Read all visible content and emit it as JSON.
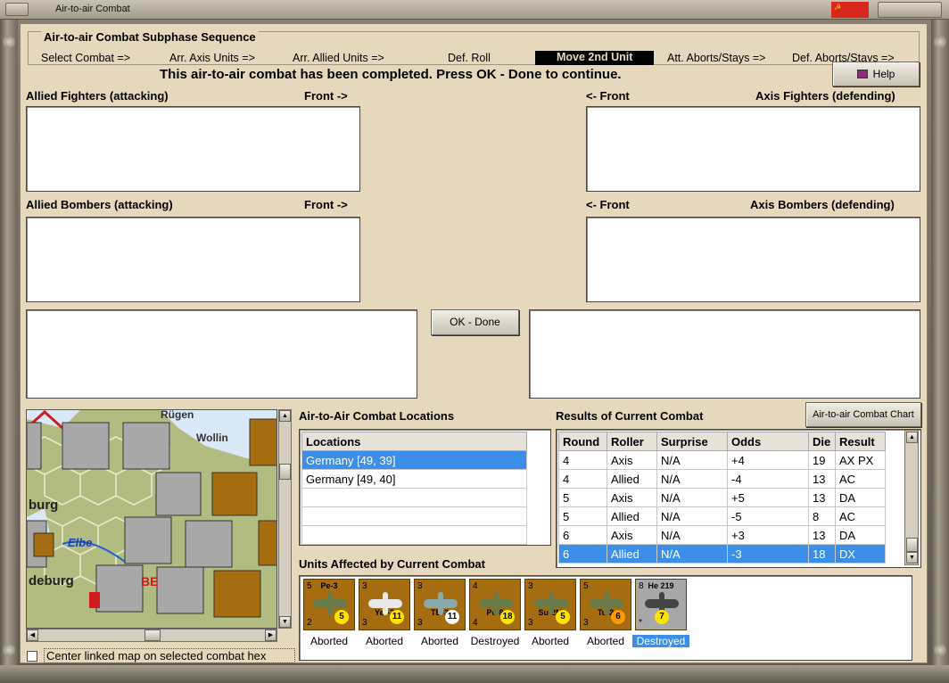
{
  "window": {
    "title": "Air-to-air Combat"
  },
  "sequence": {
    "title": "Air-to-air Combat Subphase Sequence",
    "steps": [
      "Select Combat =>",
      "Arr. Axis Units =>",
      "Arr. Allied Units =>",
      "Def. Roll",
      "Move 2nd Unit",
      "Att. Aborts/Stays =>",
      "Def. Aborts/Stays =>"
    ],
    "active_index": 4
  },
  "message": "This air-to-air combat has been completed.  Press OK - Done to continue.",
  "help_label": "Help",
  "labels": {
    "allied_fighters": "Allied Fighters (attacking)",
    "front_right": "Front ->",
    "front_left": "<- Front",
    "axis_fighters": "Axis Fighters (defending)",
    "allied_bombers": "Allied Bombers (attacking)",
    "axis_bombers": "Axis Bombers (defending)"
  },
  "ok_label": "OK - Done",
  "map": {
    "labels": [
      "Rügen",
      "Wollin",
      "burg",
      "Elbe",
      "deburg",
      "BE"
    ]
  },
  "locations": {
    "title": "Air-to-Air Combat Locations",
    "header": "Locations",
    "rows": [
      "Germany [49, 39]",
      "Germany [49, 40]"
    ],
    "selected": 0
  },
  "results": {
    "title": "Results of Current Combat",
    "chart_button": "Air-to-air Combat Chart",
    "headers": [
      "Round",
      "Roller",
      "Surprise",
      "Odds",
      "Die",
      "Result"
    ],
    "rows": [
      [
        "4",
        "Axis",
        "N/A",
        "+4",
        "19",
        "AX PX"
      ],
      [
        "4",
        "Allied",
        "N/A",
        "-4",
        "13",
        "AC"
      ],
      [
        "5",
        "Axis",
        "N/A",
        "+5",
        "13",
        "DA"
      ],
      [
        "5",
        "Allied",
        "N/A",
        "-5",
        "8",
        "AC"
      ],
      [
        "6",
        "Axis",
        "N/A",
        "+3",
        "13",
        "DA"
      ],
      [
        "6",
        "Allied",
        "N/A",
        "-3",
        "18",
        "DX"
      ]
    ],
    "selected": 5
  },
  "units": {
    "title": "Units Affected by Current Combat",
    "items": [
      {
        "name": "Pe-3",
        "status": "Aborted",
        "die": "5",
        "tl": "5",
        "bl": "2"
      },
      {
        "name": "Yer-2",
        "status": "Aborted",
        "die": "11",
        "tl": "3",
        "bl": "3"
      },
      {
        "name": "TB-3",
        "status": "Aborted",
        "die": "11",
        "tl": "3",
        "bl": "3"
      },
      {
        "name": "Pe-8",
        "status": "Destroyed",
        "die": "18",
        "tl": "4",
        "bl": "4"
      },
      {
        "name": "Su-2M",
        "status": "Aborted",
        "die": "5",
        "tl": "3",
        "bl": "3"
      },
      {
        "name": "Tu-2",
        "status": "Aborted",
        "die": "6",
        "tl": "5",
        "bl": "3"
      },
      {
        "name": "He 219",
        "status": "Destroyed",
        "die": "7",
        "tl": "8",
        "bl": "*"
      }
    ],
    "selected": 6
  },
  "center_linked_label": "Center linked map on selected combat hex"
}
